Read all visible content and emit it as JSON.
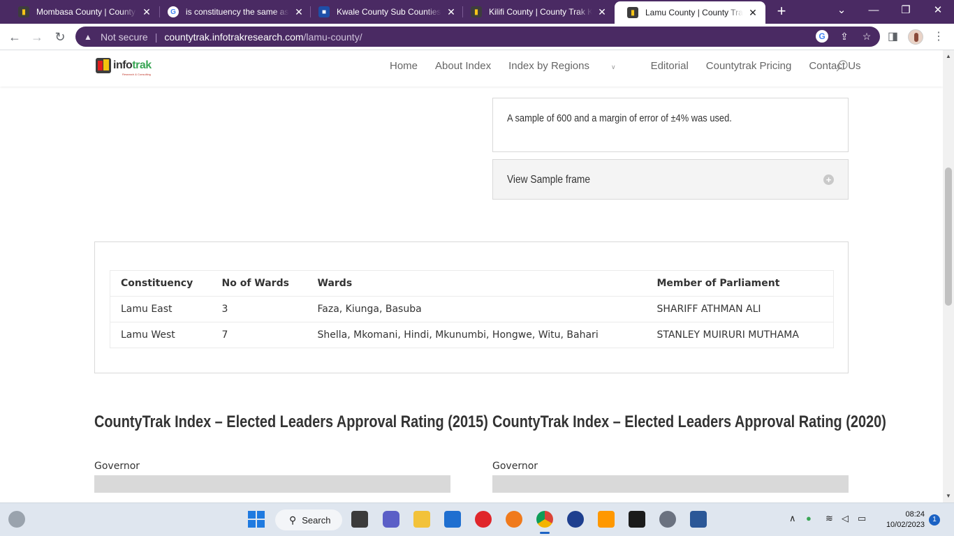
{
  "browser": {
    "tabs": [
      {
        "title": "Mombasa County | County Tr",
        "favicon": "infotrak-favicon",
        "active": false
      },
      {
        "title": "is constituency the same as s",
        "favicon": "google-favicon",
        "active": false
      },
      {
        "title": "Kwale County Sub Counties",
        "favicon": "blue-favicon",
        "active": false
      },
      {
        "title": "Kilifi County | County Trak Ke",
        "favicon": "infotrak-favicon",
        "active": false
      },
      {
        "title": "Lamu County | County Trak K",
        "favicon": "infotrak-favicon",
        "active": true
      }
    ],
    "security_label": "Not secure",
    "url_host": "countytrak.infotrakresearch.com",
    "url_path": "/lamu-county/",
    "accent_color": "#4a2a63"
  },
  "site": {
    "logo_text_a": "info",
    "logo_text_b": "trak",
    "logo_tagline": "Research & Consulting",
    "nav": [
      "Home",
      "About Index",
      "Index by Regions",
      "Editorial",
      "Countytrak Pricing",
      "Contact Us"
    ]
  },
  "content": {
    "sample_text": "A sample of 600 and a margin of error of ±4% was used.",
    "toggle_label": "View Sample frame",
    "table": {
      "headers": [
        "Constituency",
        "No of Wards",
        "Wards",
        "Member of Parliament"
      ],
      "rows": [
        [
          "Lamu East",
          "3",
          "Faza, Kiunga, Basuba",
          "SHARIFF ATHMAN ALI"
        ],
        [
          "Lamu West",
          "7",
          "Shella, Mkomani, Hindi, Mkunumbi, Hongwe, Witu, Bahari",
          "STANLEY MUIRURI MUTHAMA"
        ]
      ]
    },
    "rating_2015_title": "CountyTrak Index – Elected Leaders Approval Rating (2015)",
    "rating_2020_title": "CountyTrak Index – Elected Leaders Approval Rating (2020)",
    "governor_label": "Governor"
  },
  "taskbar": {
    "search_label": "Search",
    "time": "08:24",
    "date": "10/02/2023",
    "notifications": "1"
  }
}
